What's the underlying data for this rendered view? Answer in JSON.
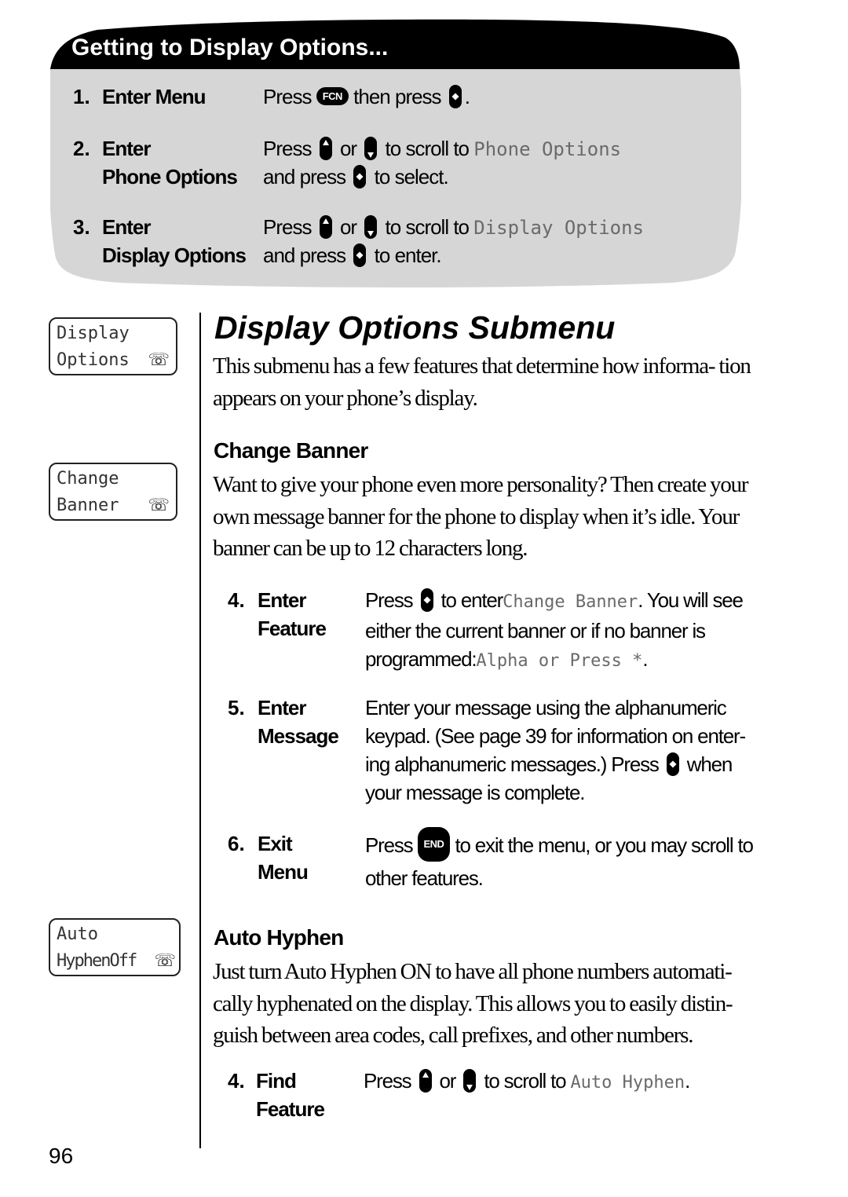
{
  "getting_to": {
    "title": "Getting to Display  Options...",
    "steps": [
      {
        "num": "1.",
        "label_line1": "Enter Menu",
        "label_line2": "",
        "text_a": "Press",
        "key1": "FCN",
        "text_b": "then press",
        "text_c": "."
      },
      {
        "num": "2.",
        "label_line1": "Enter",
        "label_line2": "Phone Options",
        "text_a": "Press",
        "text_or": "or",
        "text_b": "to scroll to",
        "lcd": "Phone Options",
        "text_line2_a": "and press",
        "text_line2_b": "to select."
      },
      {
        "num": "3.",
        "label_line1": "Enter",
        "label_line2": "Display Options",
        "text_a": "Press",
        "text_or": "or",
        "text_b": "to scroll to",
        "lcd": "Display Options",
        "text_line2_a": "and press",
        "text_line2_b": "to enter."
      }
    ]
  },
  "side_displays": [
    {
      "line1": "Display",
      "line2": "Options",
      "icon": "phone-icon"
    },
    {
      "line1": "Change",
      "line2": "Banner",
      "icon": "phone-icon"
    },
    {
      "line1": "Auto",
      "line2": "HyphenOff",
      "icon": "phone-icon"
    }
  ],
  "main": {
    "title": "Display Options Submenu",
    "intro": "This submenu has a few features that determine how informa- tion appears on your phone’s display.",
    "change_banner": {
      "heading": "Change Banner",
      "body": "Want to give your phone even more personality? Then create your own message banner for the phone to display when it’s idle. Your banner can be up to 12 characters long.",
      "steps": [
        {
          "num": "4.",
          "label1": "Enter",
          "label2": "Feature",
          "t1": "Press",
          "t2": "to enter",
          "lcd1": "Change Banner",
          "t3": ". You will see either the current banner or if no banner is programmed:",
          "lcd2": "Alpha or Press *",
          "t4": "."
        },
        {
          "num": "5.",
          "label1": "Enter",
          "label2": "Message",
          "t1": "Enter your message using the alphanumeric keypad. (See page 39 for information on enter- ing alphanumeric messages.) Press",
          "t2": "when your message is complete."
        },
        {
          "num": "6.",
          "label1": "Exit",
          "label2": "Menu",
          "t1": "Press",
          "key": "END",
          "t2": "to exit the menu, or you may scroll to other features."
        }
      ]
    },
    "auto_hyphen": {
      "heading": "Auto Hyphen",
      "body": "Just turn Auto Hyphen ON to have all phone numbers automati- cally hyphenated on the display. This allows you to easily distin- guish between area codes, call prefixes, and other numbers.",
      "steps": [
        {
          "num": "4.",
          "label1": "Find",
          "label2": "Feature",
          "t1": "Press",
          "t_or": "or",
          "t2": "to scroll to",
          "lcd": "Auto Hyphen",
          "t3": "."
        }
      ]
    }
  },
  "page_number": "96",
  "colors": {
    "box_gray": "#d6d6d6",
    "header_black": "#000000",
    "lcd_text": "#6a6a6a"
  }
}
